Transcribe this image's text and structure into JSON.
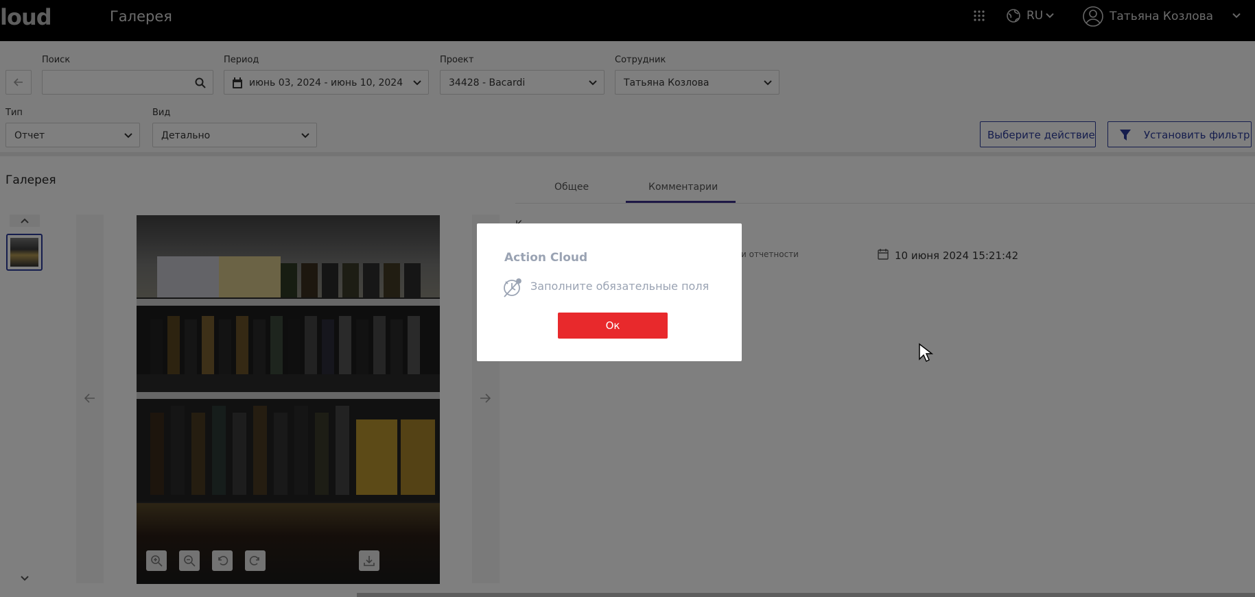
{
  "app": {
    "logo": "loud",
    "title": "Галерея",
    "language": "RU",
    "user_name": "Татьяна Козлова"
  },
  "filters": {
    "search_label": "Поиск",
    "search_value": "",
    "period_label": "Период",
    "period_value": "июнь 03, 2024 - июнь 10, 2024",
    "project_label": "Проект",
    "project_value": "34428 - Bacardi",
    "employee_label": "Сотрудник",
    "employee_value": "Татьяна Козлова",
    "type_label": "Тип",
    "type_value": "Отчет",
    "view_label": "Вид",
    "view_value": "Детально",
    "action_button": "Выберите действие",
    "filter_button": "Установить фильтр"
  },
  "gallery": {
    "title": "Галерея"
  },
  "tabs": [
    {
      "label": "Общее",
      "active": false
    },
    {
      "label": "Комментарии",
      "active": true
    }
  ],
  "details": {
    "partial_label": "и отчетности",
    "first_char": "К",
    "date": "10 июня 2024 15:21:42"
  },
  "modal": {
    "title": "Action Cloud",
    "message": "Заполните обязательные поля",
    "ok_label": "Ок",
    "ok_color": "#e8292c"
  },
  "colors": {
    "navbar": "#000000",
    "accent": "#2a3a9a",
    "tab_active": "#3b2f8a"
  },
  "icons": [
    "apps-icon",
    "globe-icon",
    "chevron-down-icon",
    "user-icon",
    "search-icon",
    "calendar-icon",
    "filter-icon",
    "arrow-left-icon",
    "arrow-right-icon",
    "zoom-in-icon",
    "zoom-out-icon",
    "rotate-left-icon",
    "rotate-right-icon",
    "download-icon",
    "warning-clock-icon"
  ]
}
